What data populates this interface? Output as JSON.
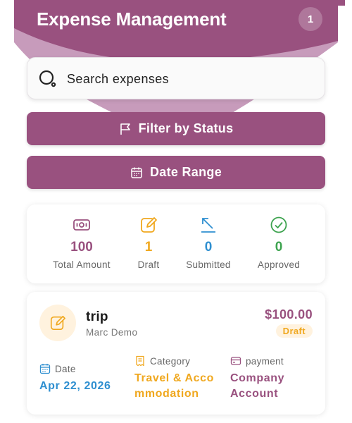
{
  "header": {
    "title": "Expense Management",
    "notification_count": "1",
    "primary_color": "#99517f"
  },
  "search": {
    "placeholder": "Search expenses",
    "icon": "search-icon"
  },
  "buttons": {
    "filter_label": "Filter by Status",
    "filter_icon": "flag-icon",
    "date_label": "Date Range",
    "date_icon": "calendar-icon"
  },
  "stats": [
    {
      "value": "100",
      "label": "Total Amount",
      "color": "#99517f",
      "icon": "money-icon"
    },
    {
      "value": "1",
      "label": "Draft",
      "color": "#f0a81f",
      "icon": "edit-icon"
    },
    {
      "value": "0",
      "label": "Submitted",
      "color": "#2f8fd0",
      "icon": "upload-arrow-icon"
    },
    {
      "value": "0",
      "label": "Approved",
      "color": "#3da34f",
      "icon": "check-circle-icon"
    }
  ],
  "expense": {
    "title": "trip",
    "user": "Marc Demo",
    "amount": "$100.00",
    "status": "Draft",
    "date_label": "Date",
    "date_value": "Apr 22, 2026",
    "category_label": "Category",
    "category_value_line1": "Travel & Acco",
    "category_value_line2": "mmodation",
    "payment_label": "payment",
    "payment_value_line1": "Company",
    "payment_value_line2": "Account"
  }
}
